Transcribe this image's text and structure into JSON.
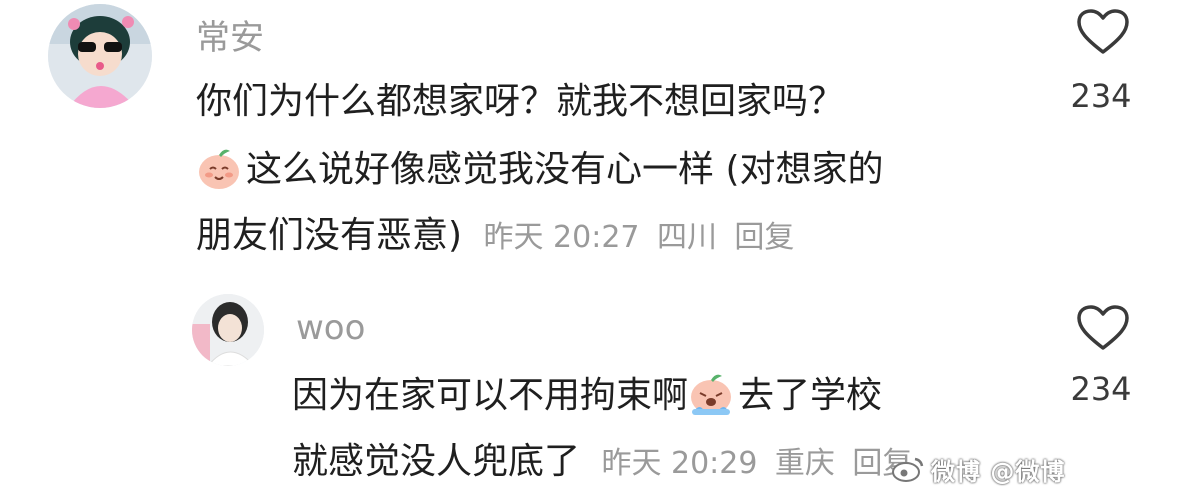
{
  "comment1": {
    "username": "常安",
    "line1": "你们为什么都想家呀？就我不想回家吗？",
    "line2": "这么说好像感觉我没有心一样 (对想家的",
    "line3": "朋友们没有恶意)",
    "time": "昨天 20:27",
    "location": "四川",
    "reply": "回复",
    "likes": "234",
    "emoji": "smiling-peach-emoji"
  },
  "comment2": {
    "username": "woo",
    "line1_a": "因为在家可以不用拘束啊",
    "line1_b": "去了学校",
    "line2": "就感觉没人兜底了",
    "time": "昨天 20:29",
    "location": "重庆",
    "reply": "回复",
    "likes": "234",
    "emoji": "crying-peach-emoji"
  },
  "watermark": {
    "text": "微博 @微博"
  },
  "colors": {
    "name": "#9a9a9a",
    "text": "#1f1f1f",
    "meta": "#9a9a9a",
    "background": "#ffffff"
  }
}
